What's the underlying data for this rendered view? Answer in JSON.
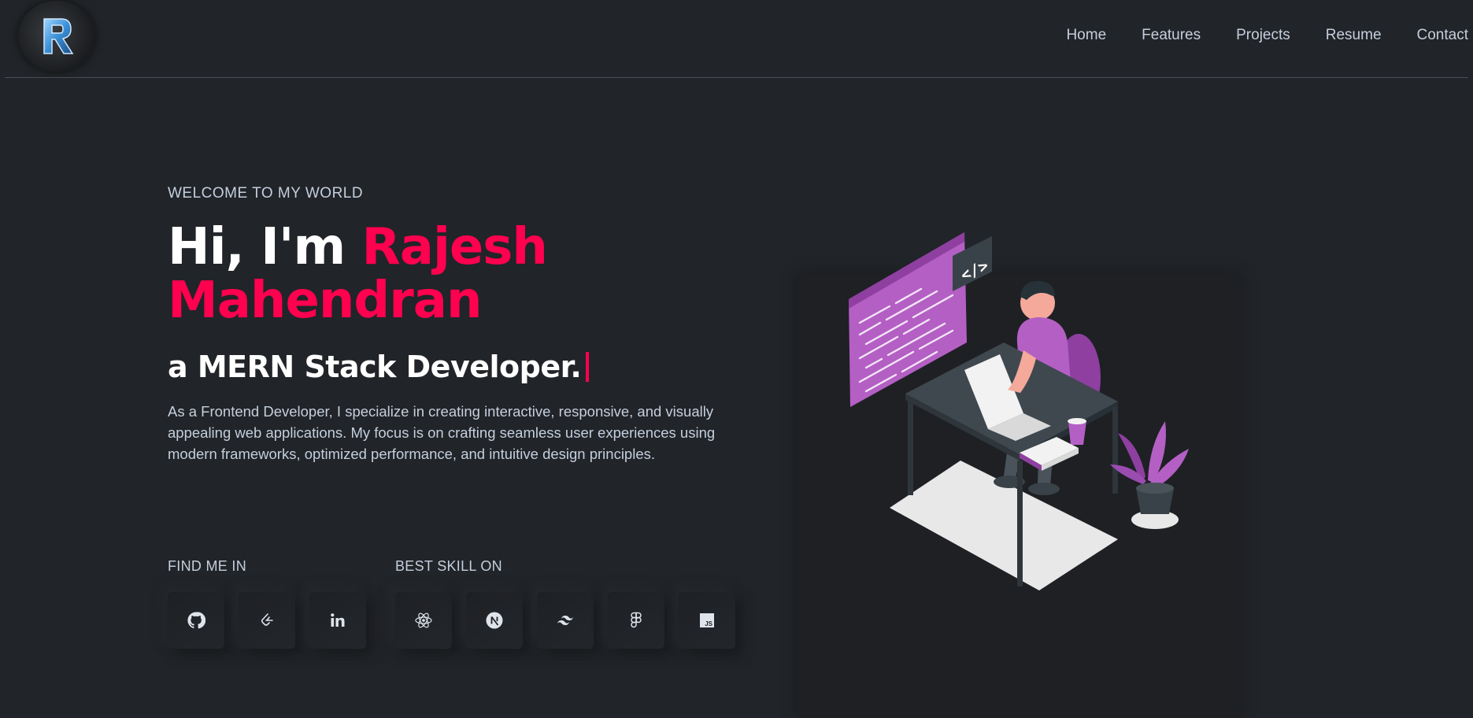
{
  "header": {
    "logo_letter": "R",
    "nav": [
      "Home",
      "Features",
      "Projects",
      "Resume",
      "Contact"
    ]
  },
  "hero": {
    "welcome": "WELCOME TO MY WORLD",
    "greeting": "Hi, I'm ",
    "name_line1": "Rajesh",
    "name_line2": "Mahendran",
    "role": "a MERN Stack Developer.",
    "description": "As a Frontend Developer, I specialize in creating interactive, responsive, and visually appealing web applications. My focus is on crafting seamless user experiences using modern frameworks, optimized performance, and intuitive design principles."
  },
  "social": {
    "label": "FIND ME IN",
    "icons": [
      "github-icon",
      "leetcode-icon",
      "linkedin-icon"
    ]
  },
  "skills": {
    "label": "BEST SKILL ON",
    "icons": [
      "react-icon",
      "nextjs-icon",
      "tailwind-icon",
      "figma-icon",
      "javascript-icon"
    ]
  },
  "illustration": {
    "code_tag": "</>"
  },
  "colors": {
    "background": "#212428",
    "accent": "#ff014f",
    "text": "#c4cfde",
    "purple": "#b45fc4"
  }
}
